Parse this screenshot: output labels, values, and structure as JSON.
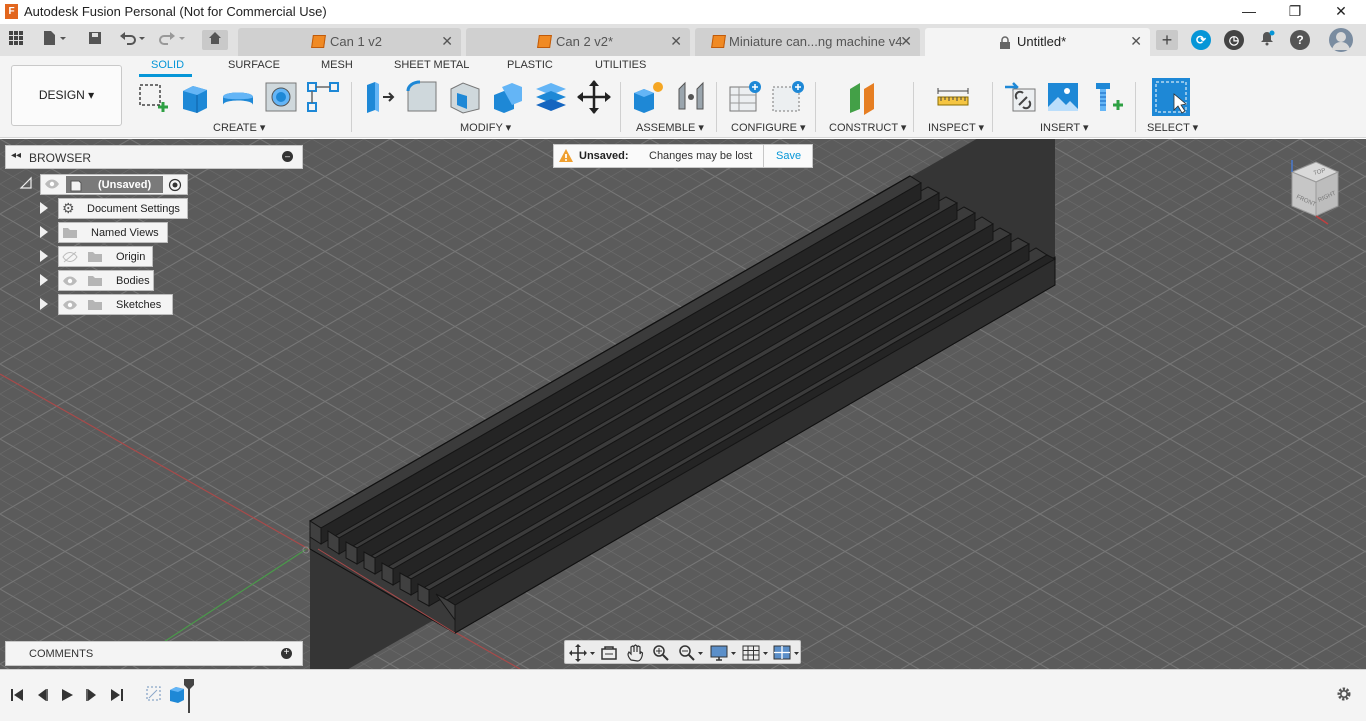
{
  "window": {
    "title": "Autodesk Fusion Personal (Not for Commercial Use)"
  },
  "tabs": [
    {
      "label": "Can 1 v2"
    },
    {
      "label": "Can 2 v2*"
    },
    {
      "label": "Miniature can...ng machine v4"
    },
    {
      "label": "Untitled*"
    }
  ],
  "workspace": {
    "label": "DESIGN"
  },
  "toolbar_tabs": [
    "SOLID",
    "SURFACE",
    "MESH",
    "SHEET METAL",
    "PLASTIC",
    "UTILITIES"
  ],
  "groups": [
    "CREATE",
    "MODIFY",
    "ASSEMBLE",
    "CONFIGURE",
    "CONSTRUCT",
    "INSPECT",
    "INSERT",
    "SELECT"
  ],
  "browser": {
    "title": "BROWSER",
    "root": "(Unsaved)",
    "items": [
      "Document Settings",
      "Named Views",
      "Origin",
      "Bodies",
      "Sketches"
    ]
  },
  "notification": {
    "title": "Unsaved:",
    "message": "Changes may be lost",
    "action": "Save"
  },
  "comments": {
    "title": "COMMENTS"
  },
  "viewcube": {
    "top": "TOP",
    "front": "FRONT",
    "right": "RIGHT"
  },
  "colors": {
    "accent": "#0696d7",
    "orange": "#e2661e",
    "viewport": "#5d5d5d"
  }
}
